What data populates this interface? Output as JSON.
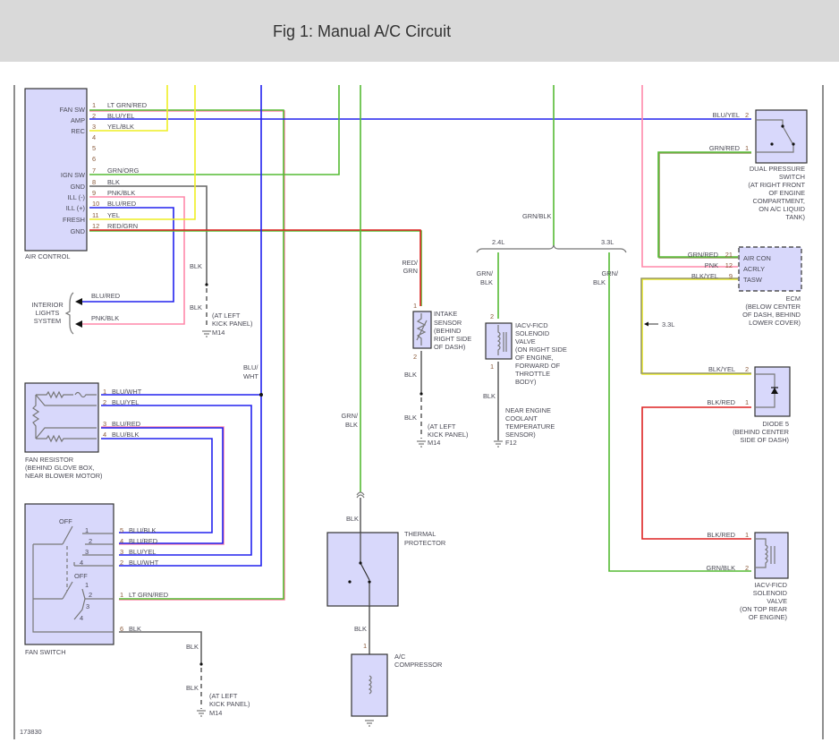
{
  "header": {
    "title": "Fig 1: Manual A/C Circuit"
  },
  "figure_id": "173830",
  "air_control": {
    "name": "AIR CONTROL",
    "pins": [
      {
        "n": "1",
        "label": "FAN SW",
        "wire": "LT GRN/RED"
      },
      {
        "n": "2",
        "label": "AMP",
        "wire": "BLU/YEL"
      },
      {
        "n": "3",
        "label": "REC",
        "wire": "YEL/BLK"
      },
      {
        "n": "4"
      },
      {
        "n": "5"
      },
      {
        "n": "6"
      },
      {
        "n": "7",
        "label": "IGN SW",
        "wire": "GRN/ORG"
      },
      {
        "n": "8",
        "label": "GND",
        "wire": "BLK"
      },
      {
        "n": "9",
        "label": "ILL (-)",
        "wire": "PNK/BLK"
      },
      {
        "n": "10",
        "label": "ILL (+)",
        "wire": "BLU/RED"
      },
      {
        "n": "11",
        "label": "FRESH",
        "wire": "YEL"
      },
      {
        "n": "12",
        "label": "GND",
        "wire": "RED/GRN"
      }
    ]
  },
  "ground_m14_top": {
    "wire1": "BLK",
    "wire2": "BLK",
    "loc": [
      "(AT LEFT",
      "KICK PANEL)"
    ],
    "id": "M14"
  },
  "interior_lights": {
    "name": [
      "INTERIOR",
      "LIGHTS",
      "SYSTEM"
    ],
    "wire1": "BLU/RED",
    "wire2": "PNK/BLK"
  },
  "blu_wht_label": [
    "BLU/",
    "WHT"
  ],
  "fan_resistor": {
    "name": [
      "FAN RESISTOR",
      "(BEHIND GLOVE BOX,",
      "NEAR BLOWER MOTOR)"
    ],
    "pins": [
      {
        "n": "1",
        "wire": "BLU/WHT"
      },
      {
        "n": "2",
        "wire": "BLU/YEL"
      },
      {
        "n": "3",
        "wire": "BLU/RED"
      },
      {
        "n": "4",
        "wire": "BLU/BLK"
      }
    ]
  },
  "fan_switch": {
    "name": "FAN SWITCH",
    "off1": "OFF",
    "off2": "OFF",
    "positions": [
      "1",
      "2",
      "3",
      "4"
    ],
    "pins": [
      {
        "n": "5",
        "wire": "BLU/BLK"
      },
      {
        "n": "4",
        "wire": "BLU/RED"
      },
      {
        "n": "3",
        "wire": "BLU/YEL"
      },
      {
        "n": "2",
        "wire": "BLU/WHT"
      },
      {
        "n": "1",
        "wire": "LT GRN/RED"
      },
      {
        "n": "6",
        "wire": "BLK"
      }
    ]
  },
  "ground_m14_bottom": {
    "wire1": "BLK",
    "wire2": "BLK",
    "loc": [
      "(AT LEFT",
      "KICK PANEL)"
    ],
    "id": "M14"
  },
  "compressor_feed": {
    "wire": [
      "GRN/",
      "BLK"
    ],
    "wire2": "BLK",
    "wire3": "BLK",
    "pin": "1"
  },
  "thermal_protector": {
    "name": [
      "THERMAL",
      "PROTECTOR"
    ]
  },
  "ac_compressor": {
    "name": [
      "A/C",
      "COMPRESSOR"
    ]
  },
  "intake_sensor": {
    "wire_in": [
      "RED/",
      "GRN"
    ],
    "pin1": "1",
    "pin2": "2",
    "name": [
      "INTAKE",
      "SENSOR",
      "(BEHIND",
      "RIGHT SIDE",
      "OF DASH)"
    ],
    "wire_out1": "BLK",
    "wire_out2": "BLK",
    "loc": [
      "(AT LEFT",
      "KICK PANEL)"
    ],
    "ground": "M14"
  },
  "splice": {
    "wire": "GRN/BLK",
    "left": "2.4L",
    "right": "3.3L"
  },
  "iacv_24": {
    "wire_in": [
      "GRN/",
      "BLK"
    ],
    "pin2": "2",
    "pin1": "1",
    "name": [
      "IACV-FICD",
      "SOLENOID",
      "VALVE",
      "(ON RIGHT SIDE",
      "OF ENGINE,",
      "FORWARD OF",
      "THROTTLE",
      "BODY)"
    ],
    "wire_out": "BLK",
    "ground_loc": [
      "NEAR ENGINE",
      "COOLANT",
      "TEMPERATURE",
      "SENSOR)"
    ],
    "ground": "F12"
  },
  "branch_33_wire": [
    "GRN/",
    "BLK"
  ],
  "dual_pressure_switch": {
    "pins": [
      {
        "n": "2",
        "wire": "BLU/YEL"
      },
      {
        "n": "1",
        "wire": "GRN/RED"
      }
    ],
    "name": [
      "DUAL PRESSURE",
      "SWITCH",
      "(AT RIGHT FRONT",
      "OF ENGINE",
      "COMPARTMENT,",
      "ON A/C LIQUID",
      "TANK)"
    ]
  },
  "ecm": {
    "pins": [
      {
        "n": "21",
        "wire": "GRN/RED",
        "label": "AIR CON"
      },
      {
        "n": "12",
        "wire": "PNK",
        "label": "ACRLY"
      },
      {
        "n": "9",
        "wire": "BLK/YEL",
        "label": "TASW"
      }
    ],
    "name": [
      "ECM",
      "(BELOW CENTER",
      "OF DASH, BEHIND",
      "LOWER COVER)"
    ]
  },
  "variant_arrow": "3.3L",
  "diode5": {
    "pins": [
      {
        "n": "2",
        "wire": "BLK/YEL"
      },
      {
        "n": "1",
        "wire": "BLK/RED"
      }
    ],
    "name": [
      "DIODE 5",
      "(BEHIND CENTER",
      "SIDE OF DASH)"
    ]
  },
  "iacv_33": {
    "pins": [
      {
        "n": "1",
        "wire": "BLK/RED"
      },
      {
        "n": "2",
        "wire": "GRN/BLK"
      }
    ],
    "name": [
      "IACV-FICD",
      "SOLENOID",
      "VALVE",
      "(ON TOP REAR",
      "OF ENGINE)"
    ]
  }
}
